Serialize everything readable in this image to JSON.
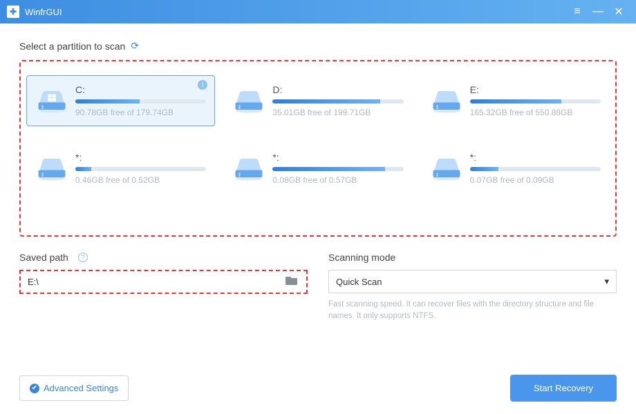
{
  "window": {
    "title": "WinfrGUI"
  },
  "partitions_label": "Select a partition to scan",
  "partitions": [
    {
      "letter": "C:",
      "free_text": "90.78GB free of 179.74GB",
      "used_pct": 49,
      "selected": true,
      "info": true,
      "has_win": true
    },
    {
      "letter": "D:",
      "free_text": "35.01GB free of 199.71GB",
      "used_pct": 82,
      "selected": false,
      "info": false,
      "has_win": false
    },
    {
      "letter": "E:",
      "free_text": "165.32GB free of 550.88GB",
      "used_pct": 70,
      "selected": false,
      "info": false,
      "has_win": false
    },
    {
      "letter": "*:",
      "free_text": "0.46GB free of 0.52GB",
      "used_pct": 12,
      "selected": false,
      "info": false,
      "has_win": false
    },
    {
      "letter": "*:",
      "free_text": "0.08GB free of 0.57GB",
      "used_pct": 86,
      "selected": false,
      "info": false,
      "has_win": false
    },
    {
      "letter": "*:",
      "free_text": "0.07GB free of 0.09GB",
      "used_pct": 22,
      "selected": false,
      "info": false,
      "has_win": false
    }
  ],
  "saved_path": {
    "label": "Saved path",
    "value": "E:\\"
  },
  "scanning_mode": {
    "label": "Scanning mode",
    "selected": "Quick Scan",
    "description": "Fast scanning speed. It can recover files with the directory structure and file names. It only supports NTFS."
  },
  "buttons": {
    "advanced": "Advanced Settings",
    "start": "Start Recovery"
  }
}
